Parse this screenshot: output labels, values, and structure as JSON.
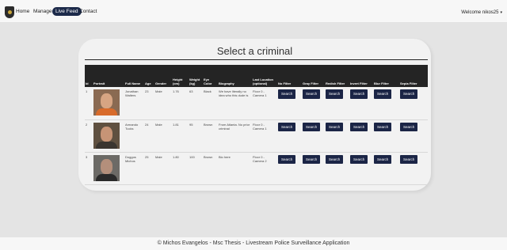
{
  "nav": {
    "items": [
      "Home",
      "Manage",
      "Live Feed",
      "Contact"
    ],
    "active": "Live Feed",
    "welcome": "Welcome nikos25"
  },
  "panel": {
    "title": "Select a criminal",
    "columns": [
      "Id",
      "Portrait",
      "Full Name",
      "Age",
      "Gender",
      "Height (cm)",
      "Weight (kg)",
      "Eye Color",
      "Biography",
      "Last Location (optional)",
      "No Filter",
      "Gray Filter",
      "Redish Filter",
      "Invert Filter",
      "Blur Filter",
      "Sepia Filter"
    ],
    "button_label": "Search",
    "rows": [
      {
        "id": "1",
        "full_name": "Jonathan Walters",
        "age": "23",
        "gender": "Male",
        "height": "1.76",
        "weight": "63",
        "eye_color": "Black",
        "biography": "We have literally no idea who this dude is",
        "last_location": "Floor 0 - Camera 1"
      },
      {
        "id": "2",
        "full_name": "Armando Tucks",
        "age": "24",
        "gender": "Male",
        "height": "1.81",
        "weight": "95",
        "eye_color": "Brown",
        "biography": "From Atlanta. No prior criminal",
        "last_location": "Floor 0 - Camera 1"
      },
      {
        "id": "3",
        "full_name": "Doggos Michos",
        "age": "25",
        "gender": "Male",
        "height": "1.80",
        "weight": "100",
        "eye_color": "Brown",
        "biography": "Bio here",
        "last_location": "Floor 0 - Camera 2"
      }
    ]
  },
  "footer": "© Michos Evangelos - Msc Thesis - Livestream Police Surveillance Application"
}
